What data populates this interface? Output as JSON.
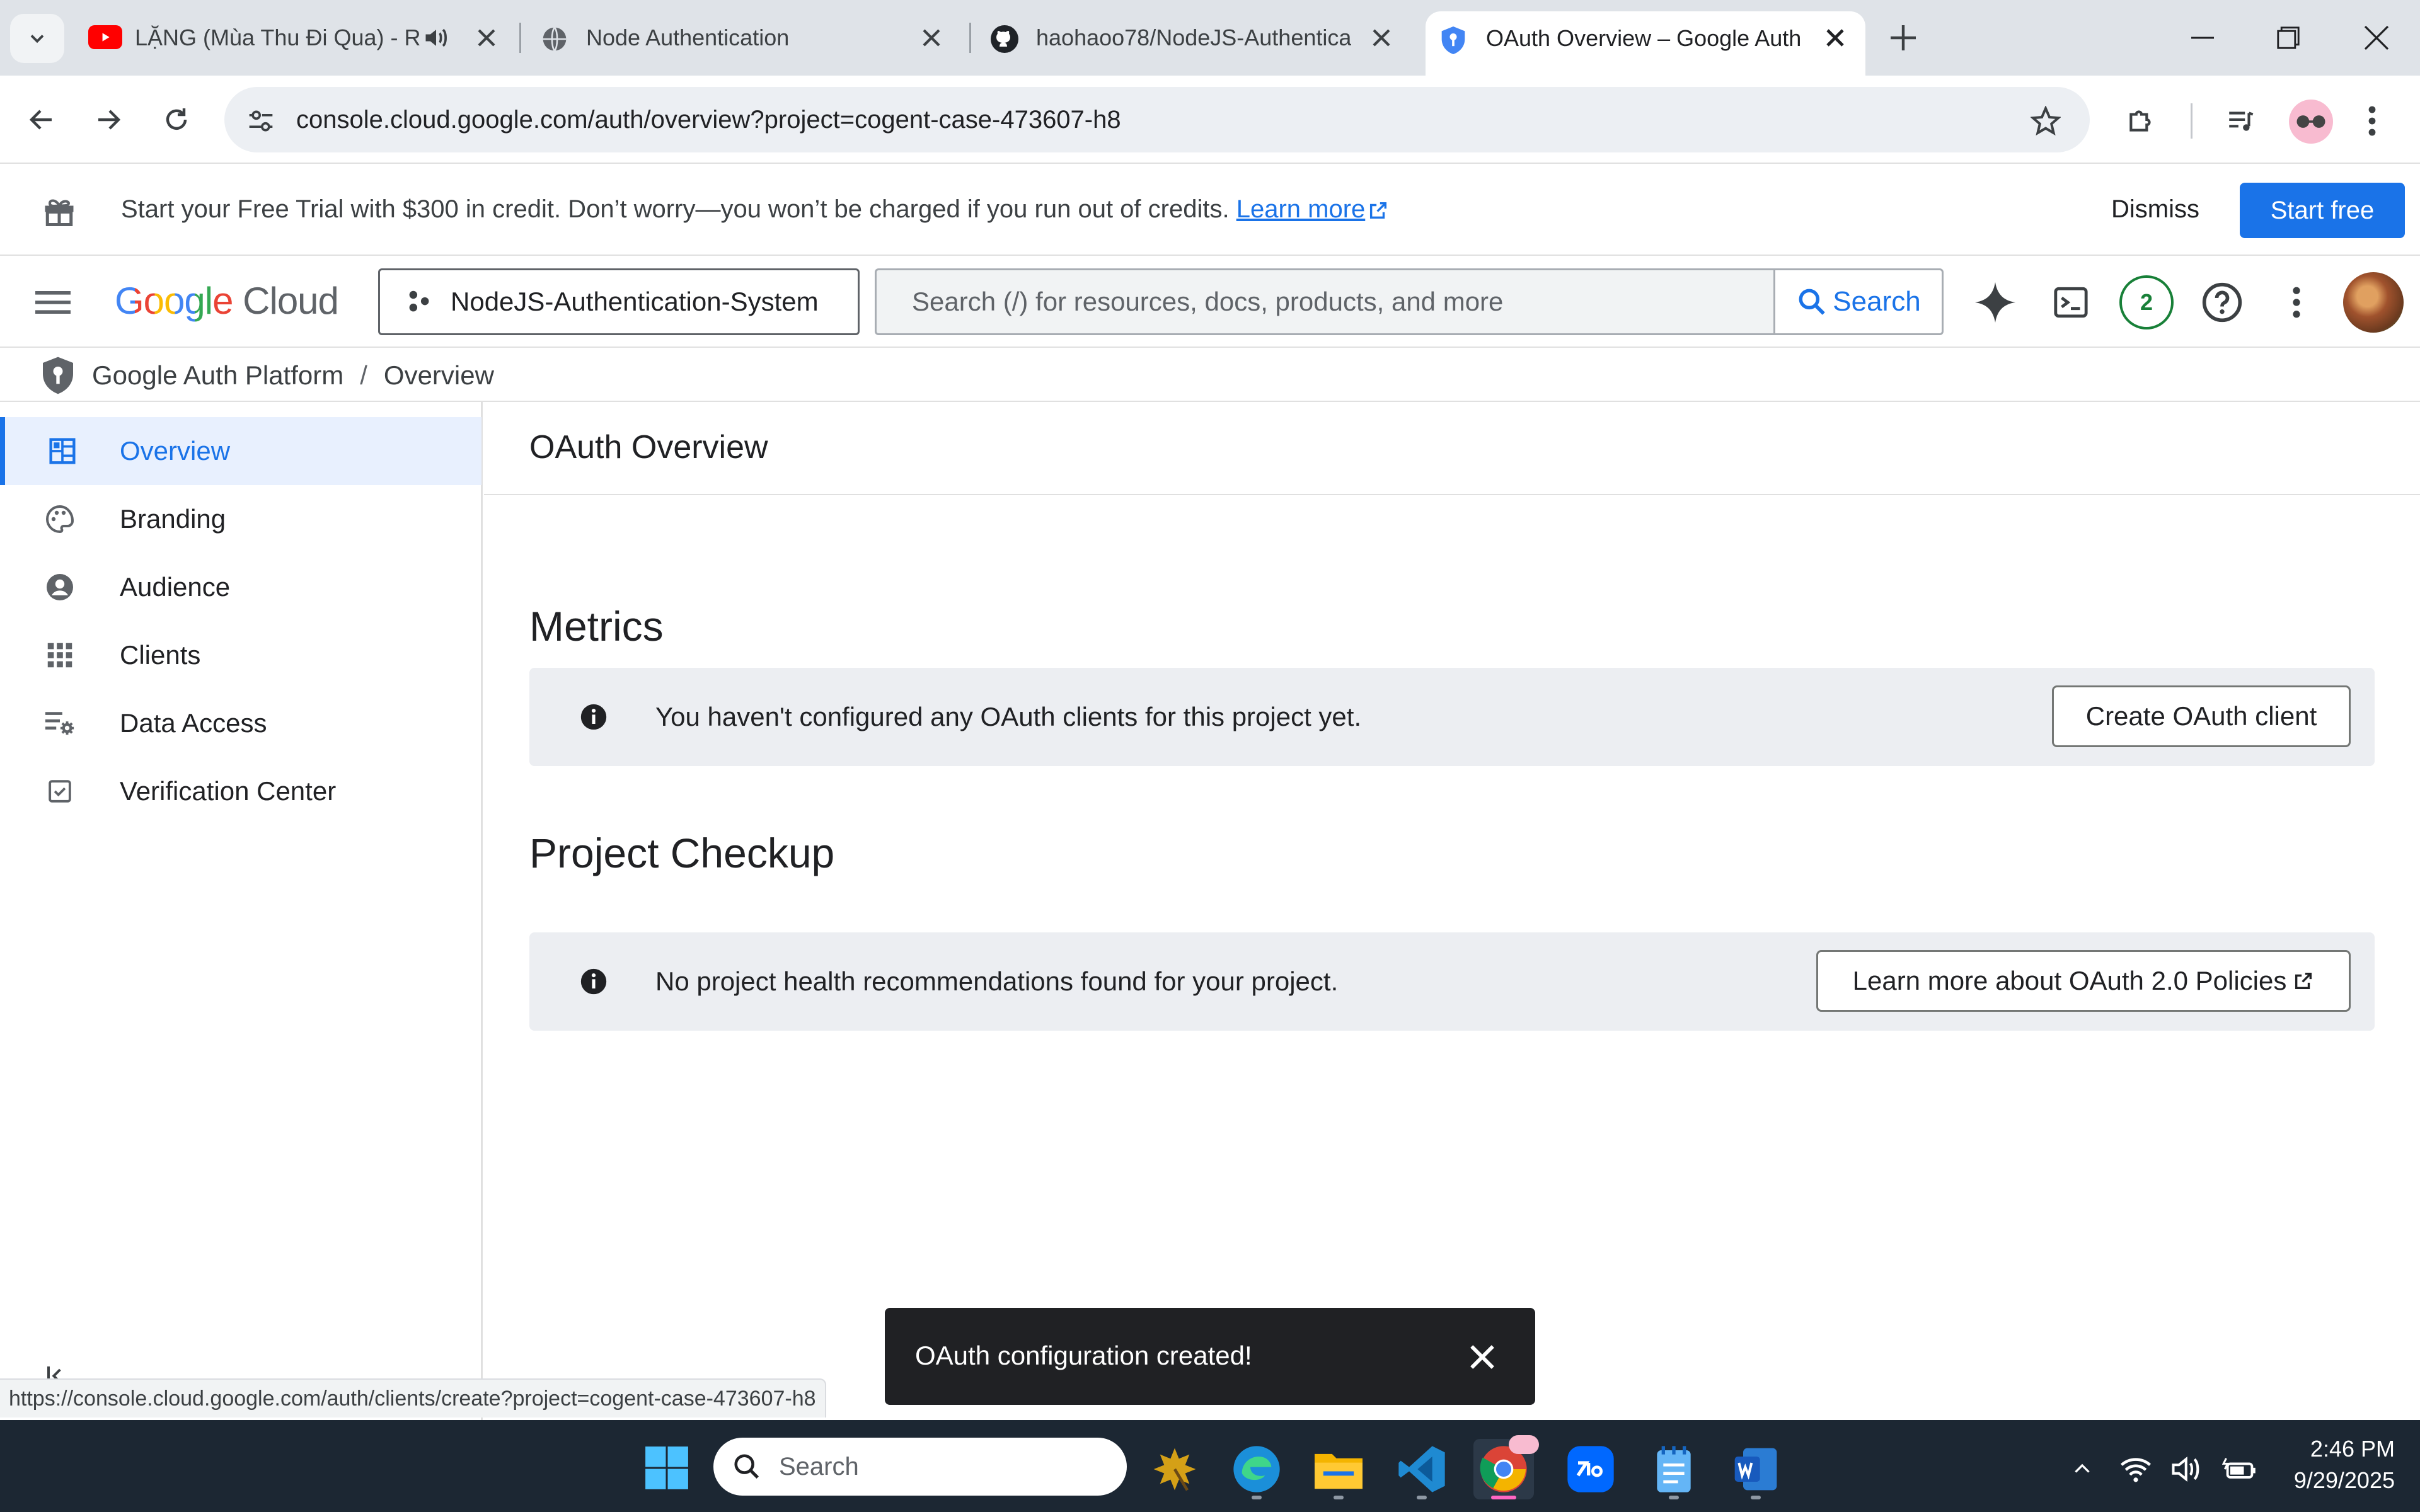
{
  "browser": {
    "tabs": [
      {
        "title": "LẶNG (Mùa Thu Đi Qua) - R",
        "icon": "youtube-icon",
        "audio": true
      },
      {
        "title": "Node Authentication",
        "icon": "globe-icon"
      },
      {
        "title": "haohaoo78/NodeJS-Authentica",
        "icon": "github-icon"
      },
      {
        "title": "OAuth Overview – Google Auth",
        "icon": "shield-icon",
        "active": true
      }
    ],
    "url": "console.cloud.google.com/auth/overview?project=cogent-case-473607-h8",
    "status_url": "https://console.cloud.google.com/auth/clients/create?project=cogent-case-473607-h8"
  },
  "banner": {
    "text": "Start your Free Trial with $300 in credit. Don’t worry—you won’t be charged if you run out of credits.",
    "learn_more": "Learn more",
    "dismiss": "Dismiss",
    "start_free": "Start free"
  },
  "header": {
    "logo_google": "Google",
    "logo_cloud": "Cloud",
    "project": "NodeJS-Authentication-System",
    "search_placeholder": "Search (/) for resources, docs, products, and more",
    "search_button": "Search",
    "notifications_count": "2"
  },
  "breadcrumb": {
    "product": "Google Auth Platform",
    "separator": "/",
    "page": "Overview"
  },
  "sidebar": {
    "items": [
      {
        "label": "Overview",
        "icon": "dashboard-icon",
        "active": true
      },
      {
        "label": "Branding",
        "icon": "palette-icon"
      },
      {
        "label": "Audience",
        "icon": "account-circle-icon"
      },
      {
        "label": "Clients",
        "icon": "apps-grid-icon"
      },
      {
        "label": "Data Access",
        "icon": "data-settings-icon"
      },
      {
        "label": "Verification Center",
        "icon": "checkbox-icon"
      }
    ]
  },
  "main": {
    "title": "OAuth Overview",
    "metrics": {
      "heading": "Metrics",
      "message": "You haven't configured any OAuth clients for this project yet.",
      "button": "Create OAuth client"
    },
    "checkup": {
      "heading": "Project Checkup",
      "message": "No project health recommendations found for your project.",
      "button": "Learn more about OAuth 2.0 Policies"
    }
  },
  "snackbar": {
    "message": "OAuth configuration created!"
  },
  "taskbar": {
    "search_placeholder": "Search",
    "time": "2:46 PM",
    "date": "9/29/2025"
  },
  "colors": {
    "accent": "#1a73e8",
    "active_nav_bg": "#e8f0fe",
    "snackbar_bg": "#202124",
    "taskbar_bg": "#1c2733"
  }
}
